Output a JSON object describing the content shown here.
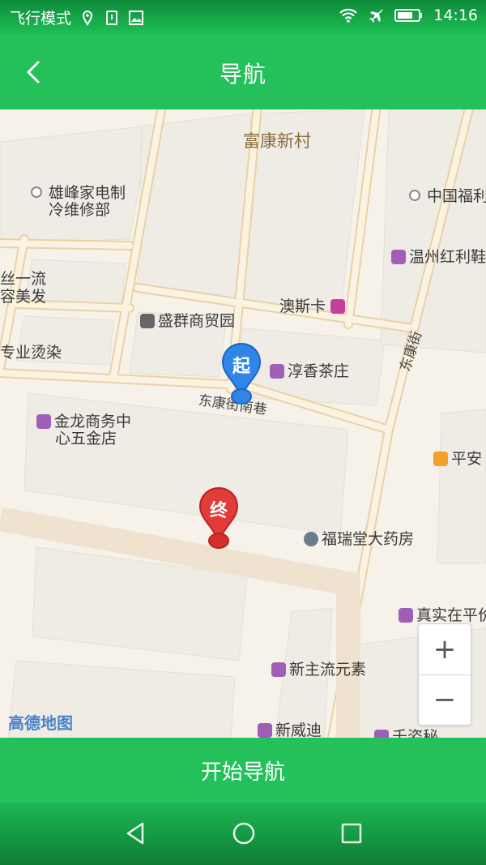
{
  "status_bar": {
    "airplane_label": "飞行模式",
    "time": "14:16",
    "icons": [
      "location-icon",
      "sim-icon",
      "image-icon",
      "wifi-icon",
      "airplane-icon",
      "battery-icon"
    ]
  },
  "header": {
    "title": "导航",
    "back_icon": "chevron-left-icon"
  },
  "map": {
    "areas": [
      "富康新村"
    ],
    "pois": [
      "雄峰家电制",
      "冷维修部",
      "中国福利",
      "温州红利鞋",
      "丝一流",
      "容美发",
      "澳斯卡",
      "盛群商贸园",
      "专业烫染",
      "淳香茶庄",
      "金龙商务中",
      "心五金店",
      "平安",
      "福瑞堂大药房",
      "真实在平价",
      "新主流元素",
      "新威迪",
      "千姿秘"
    ],
    "roads": [
      "东康街南巷",
      "东康街"
    ],
    "start_marker": "起",
    "end_marker": "终",
    "zoom_in": "+",
    "zoom_out": "−",
    "logo": "高德地图"
  },
  "start_button": "开始导航",
  "nav_bar": {
    "icons": [
      "back-triangle-icon",
      "home-circle-icon",
      "recents-square-icon"
    ]
  },
  "colors": {
    "primary": "#24c05a",
    "start_pin": "#2f86e8",
    "end_pin": "#e33a3a",
    "road": "#f3e6c9"
  }
}
